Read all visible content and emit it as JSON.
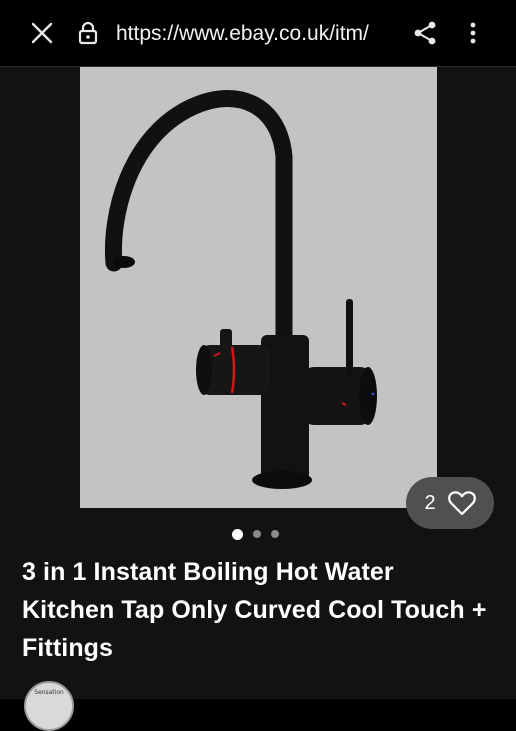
{
  "browser": {
    "url": "https://www.ebay.co.uk/itm/",
    "icons": {
      "close": "close-icon",
      "lock": "lock-icon",
      "share": "share-icon",
      "more": "more-vertical-icon"
    }
  },
  "listing": {
    "title": "3 in 1 Instant Boiling Hot Water Kitchen Tap Only Curved Cool Touch + Fittings",
    "image": {
      "description_icon": "tap-image",
      "current_index": 1,
      "total": 3
    },
    "watchers": {
      "count": "2",
      "icon": "heart-icon"
    },
    "seller": {
      "avatar_text": "Sensation"
    }
  },
  "colors": {
    "background": "#000000",
    "image_bg": "#c3c3c3",
    "watch_pill": "#505050",
    "accent_red": "#d4161b"
  }
}
